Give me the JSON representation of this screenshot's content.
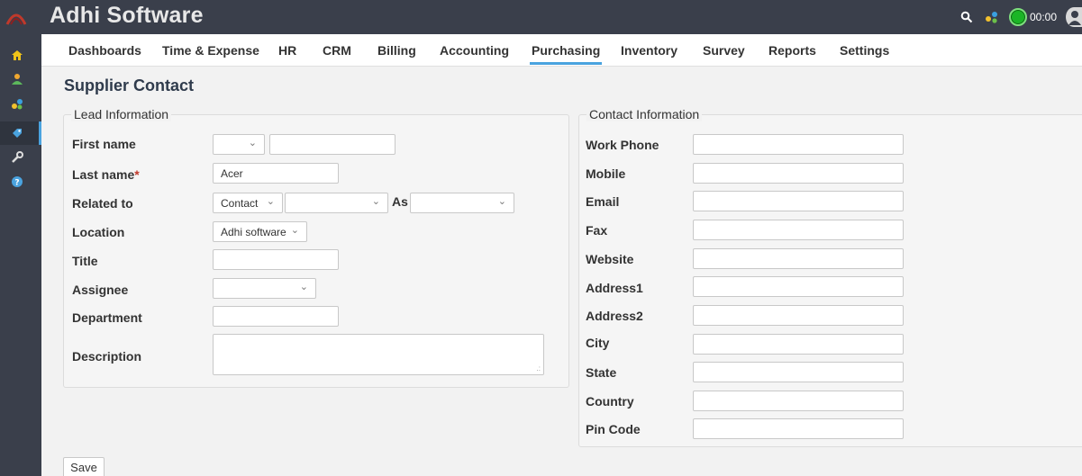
{
  "app": {
    "title": "Adhi Software"
  },
  "topbar": {
    "search_icon": "search-icon",
    "apps_icon": "apps-icon",
    "timer_value": "00:00",
    "user_icon": "user-icon"
  },
  "sidebar": {
    "items": [
      {
        "icon": "home-icon"
      },
      {
        "icon": "user-icon"
      },
      {
        "icon": "apps-icon"
      },
      {
        "icon": "tag-icon"
      },
      {
        "icon": "wrench-icon"
      },
      {
        "icon": "help-icon"
      }
    ]
  },
  "nav": {
    "items": [
      "Dashboards",
      "Time & Expense",
      "HR",
      "CRM",
      "Billing",
      "Accounting",
      "Purchasing",
      "Inventory",
      "Survey",
      "Reports",
      "Settings"
    ],
    "active": "Purchasing"
  },
  "page": {
    "title": "Supplier Contact"
  },
  "lead": {
    "legend": "Lead Information",
    "first_name_label": "First name",
    "first_name_prefix": "",
    "first_name_value": "",
    "last_name_label": "Last name",
    "last_name_required": "*",
    "last_name_value": "Acer",
    "related_to_label": "Related to",
    "related_type": "Contact",
    "related_value": "",
    "as_label": "As",
    "as_value": "",
    "location_label": "Location",
    "location_value": "Adhi software",
    "title_label": "Title",
    "title_value": "",
    "assignee_label": "Assignee",
    "assignee_value": "",
    "department_label": "Department",
    "department_value": "",
    "description_label": "Description",
    "description_value": ""
  },
  "contact": {
    "legend": "Contact Information",
    "fields": [
      {
        "label": "Work Phone",
        "value": ""
      },
      {
        "label": "Mobile",
        "value": ""
      },
      {
        "label": "Email",
        "value": ""
      },
      {
        "label": "Fax",
        "value": ""
      },
      {
        "label": "Website",
        "value": ""
      },
      {
        "label": "Address1",
        "value": ""
      },
      {
        "label": "Address2",
        "value": ""
      },
      {
        "label": "City",
        "value": ""
      },
      {
        "label": "State",
        "value": ""
      },
      {
        "label": "Country",
        "value": ""
      },
      {
        "label": "Pin Code",
        "value": ""
      }
    ]
  },
  "actions": {
    "save_label": "Save"
  },
  "colors": {
    "topbar": "#3a3f4b",
    "accent": "#4aa3df",
    "timer": "#1bb526",
    "required": "#c0392b"
  }
}
